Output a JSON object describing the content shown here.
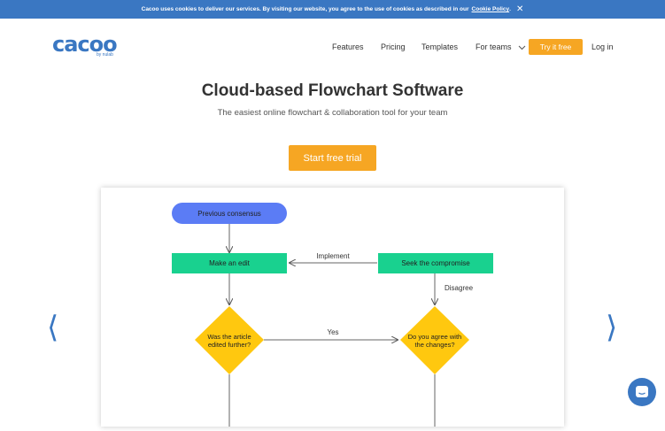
{
  "cookie_bar": {
    "text": "Cacoo uses cookies to deliver our services. By visiting our website, you agree to the use of cookies as described in our",
    "link": "Cookie Policy",
    "suffix": "."
  },
  "logo": {
    "text": "cacoo",
    "sub": "by nulab"
  },
  "nav": {
    "features": "Features",
    "pricing": "Pricing",
    "templates": "Templates",
    "for_teams": "For teams",
    "try_free": "Try it free",
    "login": "Log in"
  },
  "hero": {
    "title": "Cloud-based Flowchart Software",
    "subtitle": "The easiest online flowchart & collaboration tool for your team",
    "cta": "Start free trial"
  },
  "diagram": {
    "nodes": {
      "previous_consensus": "Previous consensus",
      "make_an_edit": "Make an edit",
      "seek_compromise": "Seek the compromise",
      "edited_further_l1": "Was the article",
      "edited_further_l2": "edited further?",
      "agree_l1": "Do you agree with",
      "agree_l2": "the changes?"
    },
    "edges": {
      "implement": "Implement",
      "disagree": "Disagree",
      "yes": "Yes"
    }
  },
  "colors": {
    "brand_blue": "#3a77c2",
    "orange": "#f6a623",
    "node_blue": "#5b7cf5",
    "node_green": "#19d18f",
    "node_yellow": "#ffc80f"
  },
  "icons": {
    "close": "close-icon",
    "chevron": "chevron-down-icon",
    "prev": "chevron-left-icon",
    "next": "chevron-right-icon",
    "chat": "chat-icon"
  }
}
